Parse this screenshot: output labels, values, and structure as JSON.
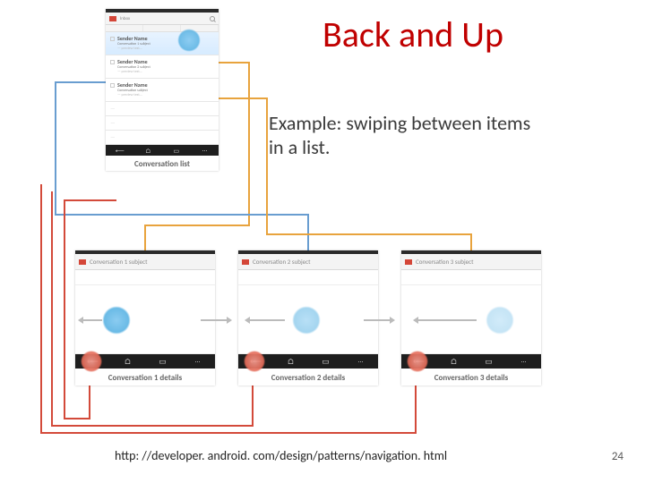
{
  "title": "Back and Up",
  "subtitle": "Example: swiping between items in a list.",
  "footer_url": "http: //developer. android. com/design/patterns/navigation. html",
  "page_number": "24",
  "list_phone": {
    "app_label": "Inbox",
    "items": [
      {
        "name": "Sender Name",
        "subject": "Conversation 1 subject",
        "highlight": true
      },
      {
        "name": "Sender Name",
        "subject": "Conversation 2 subject",
        "highlight": false
      },
      {
        "name": "Sender Name",
        "subject": "Conversation subject",
        "highlight": false
      }
    ],
    "caption": "Conversation list"
  },
  "detail_phones": [
    {
      "header": "Conversation 1 subject",
      "caption": "Conversation 1 details"
    },
    {
      "header": "Conversation 2 subject",
      "caption": "Conversation 2 details"
    },
    {
      "header": "Conversation 3 subject",
      "caption": "Conversation 3 details"
    }
  ],
  "colors": {
    "title": "#c00000",
    "line_blue": "#699dd0",
    "line_orange": "#e8a33d",
    "line_red": "#d34a3a"
  }
}
